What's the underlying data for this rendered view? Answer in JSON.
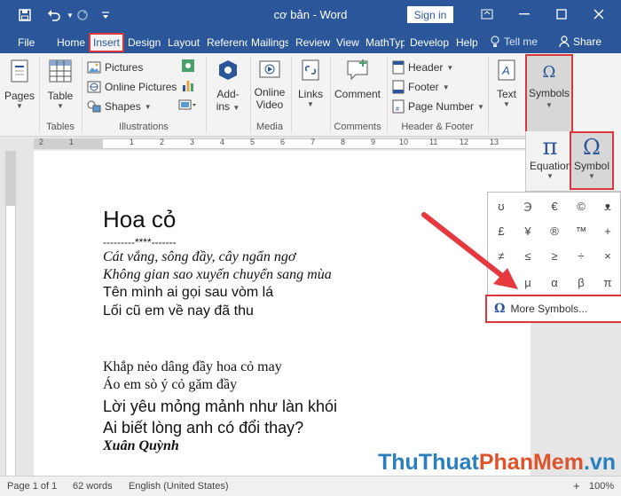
{
  "window": {
    "title": "cơ bản  -  Word",
    "signin_label": "Sign in"
  },
  "tabs": [
    "File",
    "Home",
    "Insert",
    "Design",
    "Layout",
    "Referenc",
    "Mailings",
    "Review",
    "View",
    "MathTyp",
    "Develop",
    "Help"
  ],
  "tellme_label": "Tell me",
  "share_label": "Share",
  "ribbon": {
    "pages": {
      "label": "Pages"
    },
    "table": {
      "label": "Table",
      "group": "Tables"
    },
    "illustrations": {
      "pictures": "Pictures",
      "online_pictures": "Online Pictures",
      "shapes": "Shapes",
      "group": "Illustrations"
    },
    "addins": {
      "label_line1": "Add-",
      "label_line2": "ins"
    },
    "online_video": {
      "label_line1": "Online",
      "label_line2": "Video",
      "group": "Media"
    },
    "links": {
      "label": "Links"
    },
    "comment": {
      "label": "Comment",
      "group": "Comments"
    },
    "header_footer": {
      "header": "Header",
      "footer": "Footer",
      "page_number": "Page Number",
      "group": "Header & Footer"
    },
    "text": {
      "label": "Text"
    },
    "symbols": {
      "label": "Symbols"
    },
    "equation": {
      "label": "Equation"
    },
    "symbol": {
      "label": "Symbol"
    }
  },
  "ruler_numbers": [
    "2",
    "1",
    "1",
    "2",
    "3",
    "4",
    "5",
    "6",
    "7",
    "8",
    "9",
    "10",
    "11",
    "12",
    "13"
  ],
  "document": {
    "title": "Hoa cỏ",
    "divider": "---------****-------",
    "stanza1": [
      "Cát vắng, sông đầy, cây ngẩn ngơ",
      "Không gian sao xuyến chuyển sang mùa",
      "Tên mình ai gọi sau vòm lá",
      "Lối cũ em về nay đã thu"
    ],
    "stanza2": [
      "Khắp nẻo dâng đầy hoa cỏ may",
      "Áo em sò ý cỏ găm đầy",
      "Lời yêu mỏng mảnh như làn khói",
      "Ai biết lòng anh có đổi thay?"
    ],
    "author": "Xuân Quỳnh"
  },
  "symbol_grid": [
    "ʊ",
    "℈",
    "€",
    "©",
    "ᴥ",
    "£",
    "¥",
    "®",
    "™",
    "+",
    "≠",
    "≤",
    "≥",
    "÷",
    "×",
    "∞",
    "μ",
    "α",
    "β",
    "π"
  ],
  "more_symbols_label": "More Symbols...",
  "status": {
    "page": "Page 1 of 1",
    "words": "62 words",
    "language": "English (United States)",
    "zoom": "100%"
  },
  "watermark": {
    "part1": "ThuThuat",
    "part2": "PhanMem",
    "part3": ".vn"
  },
  "colors": {
    "titlebar": "#2b579a",
    "highlight": "#d9363e",
    "arrow": "#e5393f"
  }
}
